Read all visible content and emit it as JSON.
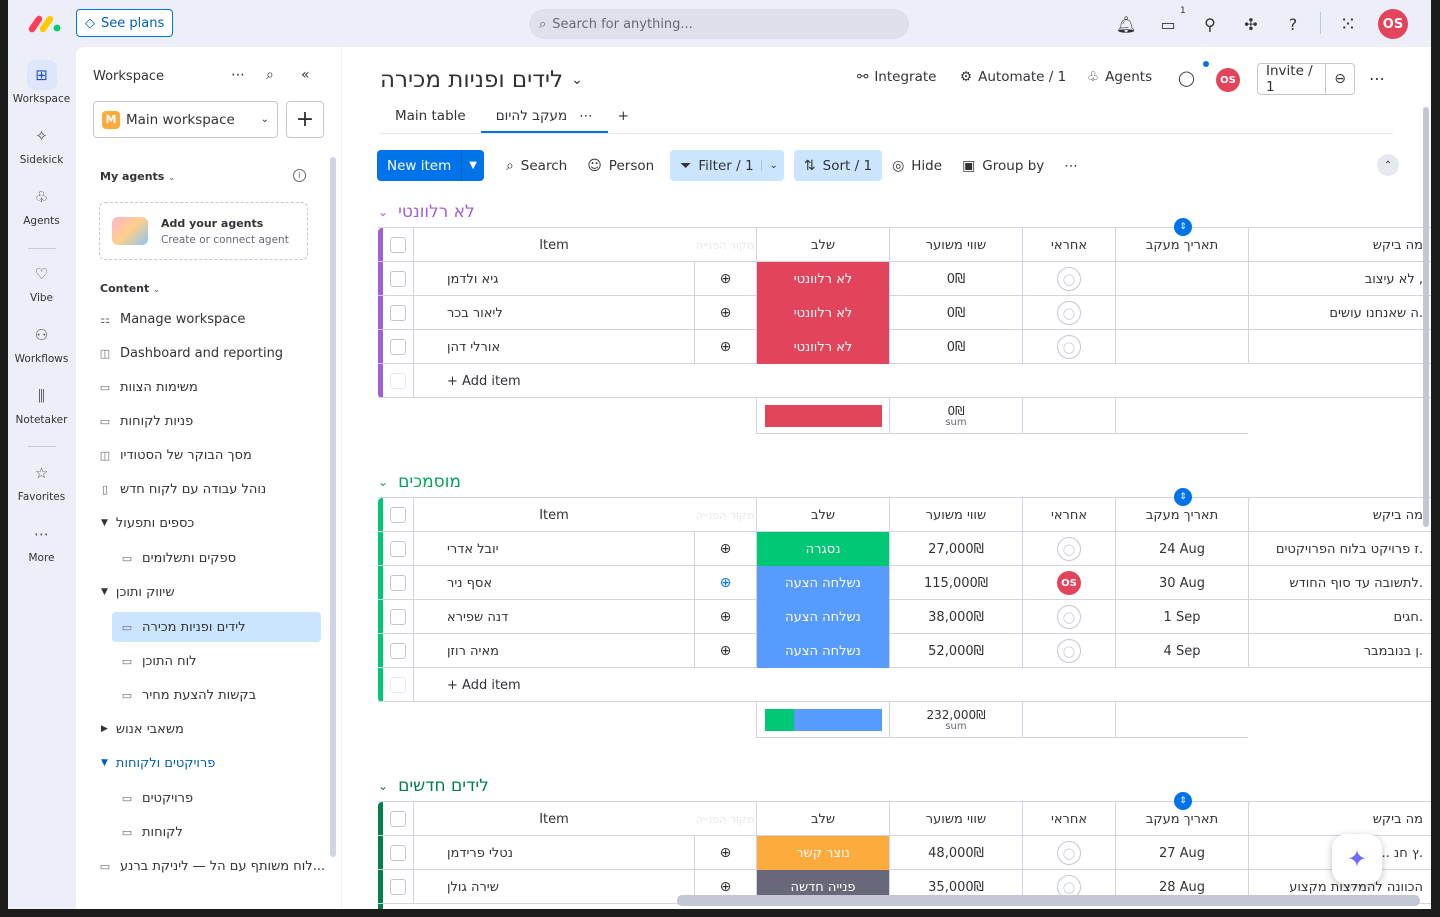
{
  "topbar": {
    "see_plans": "See plans",
    "search_placeholder": "Search for anything...",
    "inbox_count": "1",
    "avatar_initials": "OS"
  },
  "rail": {
    "items": [
      {
        "label": "Workspace",
        "icon": "grid-icon"
      },
      {
        "label": "Sidekick",
        "icon": "sparkle-icon"
      },
      {
        "label": "Agents",
        "icon": "agent-icon"
      },
      {
        "label": "Vibe",
        "icon": "heart-icon"
      },
      {
        "label": "Workflows",
        "icon": "workflow-icon"
      },
      {
        "label": "Notetaker",
        "icon": "waveform-icon"
      },
      {
        "label": "Favorites",
        "icon": "star-icon"
      },
      {
        "label": "More",
        "icon": "more-icon"
      }
    ]
  },
  "sidebar": {
    "title": "Workspace",
    "workspace_name": "Main workspace",
    "workspace_initial": "M",
    "my_agents": "My agents",
    "agent_card_title": "Add your agents",
    "agent_card_sub": "Create or connect agent",
    "content_label": "Content",
    "items": [
      {
        "label": "Manage workspace",
        "icon": "manage-icon"
      },
      {
        "label": "Dashboard and reporting",
        "icon": "dashboard-icon"
      },
      {
        "label": "משימות הצוות",
        "icon": "board-icon"
      },
      {
        "label": "פניות לקוחות",
        "icon": "board-icon"
      },
      {
        "label": "מסך הבוקר של הסטודיו",
        "icon": "dashboard-icon"
      },
      {
        "label": "נוהל עבודה עם לקוח חדש",
        "icon": "doc-icon"
      },
      {
        "label": "כספים ותפעול",
        "icon": "folder"
      },
      {
        "label": "ספקים ותשלומים",
        "icon": "board-icon"
      },
      {
        "label": "שיווק ותוכן",
        "icon": "folder"
      },
      {
        "label": "לידים ופניות מכירה",
        "icon": "board-icon"
      },
      {
        "label": "לוח התוכן",
        "icon": "board-icon"
      },
      {
        "label": "בקשות להצעת מחיר",
        "icon": "board-icon"
      },
      {
        "label": "משאבי אנוש",
        "icon": "folder"
      },
      {
        "label": "פרויקטים ולקוחות",
        "icon": "folder"
      },
      {
        "label": "פרויקטים",
        "icon": "board-icon"
      },
      {
        "label": "לקוחות",
        "icon": "board-icon"
      },
      {
        "label": "לוח משותף עם הל — ליניקת ברנע...",
        "icon": "shared-board-icon"
      }
    ]
  },
  "board": {
    "title": "לידים ופניות מכירה",
    "integrate": "Integrate",
    "automate": "Automate / 1",
    "agents": "Agents",
    "invite": "Invite / 1",
    "tabs": [
      "Main table",
      "מעקב להיום"
    ],
    "toolbar": {
      "new_item": "New item",
      "search": "Search",
      "person": "Person",
      "filter": "Filter / 1",
      "sort": "Sort / 1",
      "hide": "Hide",
      "group_by": "Group by"
    },
    "columns": {
      "item": "Item",
      "updates_ghost": "מקור הפנייה",
      "stage": "שלב",
      "value": "שווי משוער",
      "owner": "אחראי",
      "date": "תאריך מעקב",
      "request": "מה ביקש"
    },
    "add_item": "+ Add item",
    "sum_label": "sum",
    "groups": [
      {
        "title": "לא רלוונטי",
        "color": "#a25ddc",
        "rows": [
          {
            "item": "גיא ולדמן",
            "stage": "לא רלוונטי",
            "stage_color": "#e2445c",
            "value": "0₪",
            "owner": "",
            "date": "",
            "request": "לא עיצוב ,"
          },
          {
            "item": "ליאור בכר",
            "stage": "לא רלוונטי",
            "stage_color": "#e2445c",
            "value": "0₪",
            "owner": "",
            "date": "",
            "request": "ה שאנחנו עושים."
          },
          {
            "item": "אורלי דהן",
            "stage": "לא רלוונטי",
            "stage_color": "#e2445c",
            "value": "0₪",
            "owner": "",
            "date": "",
            "request": ""
          }
        ],
        "sum": "0₪"
      },
      {
        "title": "מוסמכים",
        "color": "#00c875",
        "rows": [
          {
            "item": "יובל אדרי",
            "stage": "נסגרה",
            "stage_color": "#00c875",
            "value": "27,000₪",
            "owner": "",
            "date": "24 Aug",
            "request": "ז פרויקט בלוח הפרויקטים."
          },
          {
            "item": "אסף ניר",
            "stage": "נשלחה הצעה",
            "stage_color": "#579bfc",
            "value": "115,000₪",
            "owner": "OS",
            "date": "30 Aug",
            "request": "לתשובה עד סוף החודש."
          },
          {
            "item": "דנה שפירא",
            "stage": "נשלחה הצעה",
            "stage_color": "#579bfc",
            "value": "38,000₪",
            "owner": "",
            "date": "1 Sep",
            "request": "חגים."
          },
          {
            "item": "מאיה רוזן",
            "stage": "נשלחה הצעה",
            "stage_color": "#579bfc",
            "value": "52,000₪",
            "owner": "",
            "date": "4 Sep",
            "request": "ן בנובמבר."
          }
        ],
        "sum": "232,000₪"
      },
      {
        "title": "לידים חדשים",
        "color": "#037f4c",
        "rows": [
          {
            "item": "נטלי פרידמן",
            "stage": "נוצר קשר",
            "stage_color": "#fdab3d",
            "value": "48,000₪",
            "owner": "",
            "date": "27 Aug",
            "request": "ץ חנ ...ןקין."
          },
          {
            "item": "שירה גולן",
            "stage": "פנייה חדשה",
            "stage_color": "#676879",
            "value": "35,000₪",
            "owner": "",
            "date": "28 Aug",
            "request": "הכוונה להמלצות מקצוע"
          }
        ]
      }
    ]
  }
}
